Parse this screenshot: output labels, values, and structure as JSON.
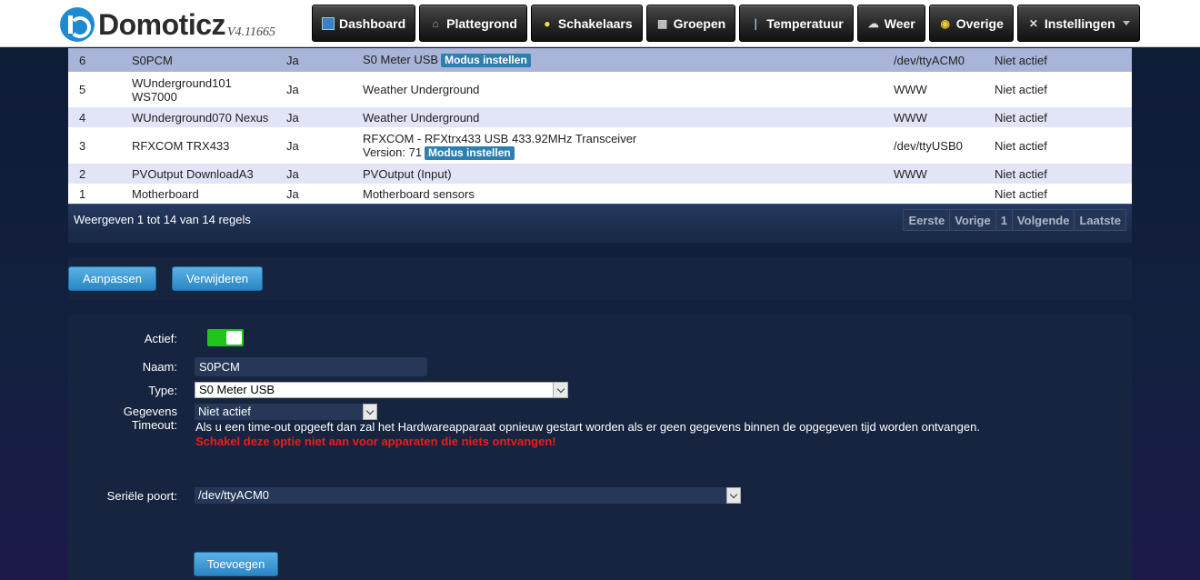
{
  "app": {
    "name": "Domoticz",
    "version": "V4.11665"
  },
  "nav": [
    {
      "label": "Dashboard",
      "icon": "dashboard-icon"
    },
    {
      "label": "Plattegrond",
      "icon": "house-icon"
    },
    {
      "label": "Schakelaars",
      "icon": "lightbulb-icon"
    },
    {
      "label": "Groepen",
      "icon": "scene-icon"
    },
    {
      "label": "Temperatuur",
      "icon": "thermometer-icon"
    },
    {
      "label": "Weer",
      "icon": "cloud-icon"
    },
    {
      "label": "Overige",
      "icon": "globe-icon"
    },
    {
      "label": "Instellingen",
      "icon": "tools-icon"
    }
  ],
  "table": {
    "rows": [
      {
        "idx": "6",
        "name": "S0PCM",
        "enabled": "Ja",
        "type": "S0 Meter USB",
        "badge": "Modus instellen",
        "address": "/dev/ttyACM0",
        "timeout": "Niet actief"
      },
      {
        "idx": "5",
        "name": "WUnderground101",
        "name2": "WS7000",
        "enabled": "Ja",
        "type": "Weather Underground",
        "address": "WWW",
        "timeout": "Niet actief"
      },
      {
        "idx": "4",
        "name": "WUnderground070 Nexus",
        "enabled": "Ja",
        "type": "Weather Underground",
        "address": "WWW",
        "timeout": "Niet actief"
      },
      {
        "idx": "3",
        "name": "RFXCOM TRX433",
        "enabled": "Ja",
        "type": "RFXCOM - RFXtrx433 USB 433.92MHz Transceiver",
        "type2": "Version: 71",
        "badge": "Modus instellen",
        "address": "/dev/ttyUSB0",
        "timeout": "Niet actief"
      },
      {
        "idx": "2",
        "name": "PVOutput DownloadA3",
        "enabled": "Ja",
        "type": "PVOutput (Input)",
        "address": "WWW",
        "timeout": "Niet actief"
      },
      {
        "idx": "1",
        "name": "Motherboard",
        "enabled": "Ja",
        "type": "Motherboard sensors",
        "address": "",
        "timeout": "Niet actief"
      }
    ],
    "info": "Weergeven 1 tot 14 van 14 regels",
    "pager": [
      "Eerste",
      "Vorige",
      "1",
      "Volgende",
      "Laatste"
    ]
  },
  "actions": {
    "update": "Aanpassen",
    "delete": "Verwijderen"
  },
  "form": {
    "active_label": "Actief:",
    "active": true,
    "name_label": "Naam:",
    "name_value": "S0PCM",
    "type_label": "Type:",
    "type_value": "S0 Meter USB",
    "timeout_label1": "Gegevens",
    "timeout_label2": "Timeout:",
    "timeout_value": "Niet actief",
    "timeout_help": "Als u een time-out opgeeft dan zal het Hardwareapparaat opnieuw gestart worden als er geen gegevens binnen de opgegeven tijd worden ontvangen.",
    "timeout_warning": "Schakel deze optie niet aan voor apparaten die niets ontvangen!",
    "serial_label": "Seriële poort:",
    "serial_value": "/dev/ttyACM0",
    "add": "Toevoegen"
  },
  "colors": {
    "accent": "#2a86c3",
    "badge": "#2d7fb0",
    "warning": "#ee1b1b",
    "toggle_on": "#22c31d"
  }
}
